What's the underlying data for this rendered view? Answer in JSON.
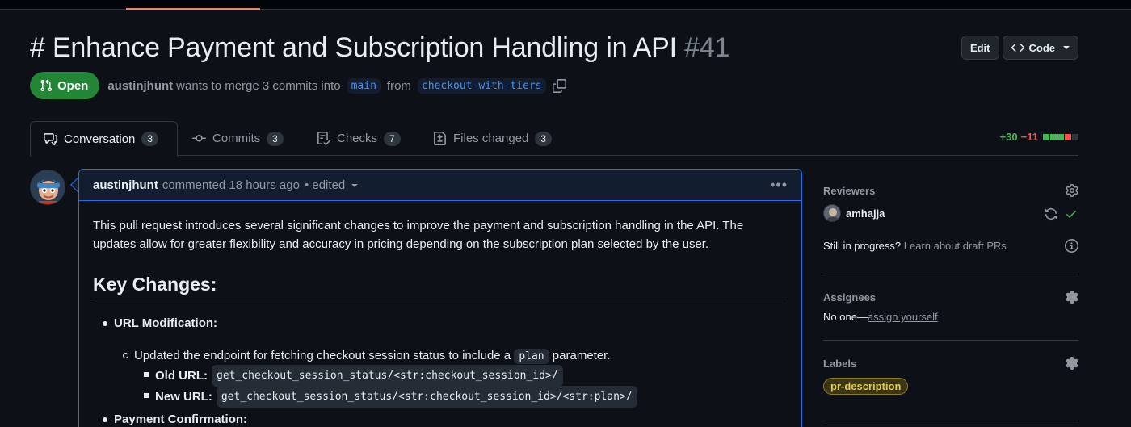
{
  "header": {
    "title": "# Enhance Payment and Subscription Handling in API",
    "number": "#41",
    "edit_label": "Edit",
    "code_label": "Code"
  },
  "state": {
    "badge": "Open",
    "author": "austinjhunt",
    "merge_text": "wants to merge 3 commits into",
    "base_branch": "main",
    "from_text": "from",
    "head_branch": "checkout-with-tiers"
  },
  "tabs": [
    {
      "label": "Conversation",
      "count": "3",
      "icon": "comment-discussion-icon"
    },
    {
      "label": "Commits",
      "count": "3",
      "icon": "commit-icon"
    },
    {
      "label": "Checks",
      "count": "7",
      "icon": "checklist-icon"
    },
    {
      "label": "Files changed",
      "count": "3",
      "icon": "file-diff-icon"
    }
  ],
  "diffstat": {
    "additions": "+30",
    "deletions": "−11",
    "colors": {
      "add": "#3fb950",
      "del": "#f85149",
      "neutral": "#30363d"
    }
  },
  "comment": {
    "author": "austinjhunt",
    "meta": "commented 18 hours ago",
    "edited": "• edited",
    "intro": "This pull request introduces several significant changes to improve the payment and subscription handling in the API. The updates allow for greater flexibility and accuracy in pricing depending on the subscription plan selected by the user.",
    "heading": "Key Changes:",
    "item1": "URL Modification:",
    "item1_sub_before": "Updated the endpoint for fetching checkout session status to include a",
    "item1_sub_code": "plan",
    "item1_sub_after": "parameter.",
    "old_label": "Old URL:",
    "old_code": "get_checkout_session_status/<str:checkout_session_id>/",
    "new_label": "New URL:",
    "new_code": "get_checkout_session_status/<str:checkout_session_id>/<str:plan>/",
    "item2": "Payment Confirmation:"
  },
  "sidebar": {
    "reviewers_title": "Reviewers",
    "reviewer_name": "amhajja",
    "progress_text": "Still in progress?",
    "progress_link": "Learn about draft PRs",
    "assignees_title": "Assignees",
    "assignees_none": "No one—",
    "assign_link": "assign yourself",
    "labels_title": "Labels",
    "label_name": "pr-description",
    "label_color": "#e2cc4a"
  }
}
